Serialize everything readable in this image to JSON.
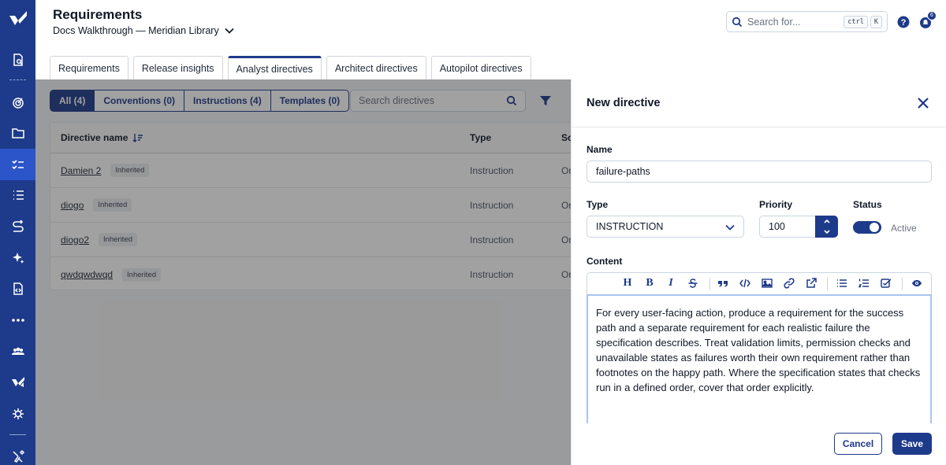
{
  "header": {
    "title": "Requirements",
    "project": "Docs Walkthrough — Meridian Library",
    "search_placeholder": "Search for...",
    "shortcut_ctrl": "ctrl",
    "shortcut_key": "K",
    "notification_count": "6"
  },
  "tabs": [
    {
      "label": "Requirements"
    },
    {
      "label": "Release insights"
    },
    {
      "label": "Analyst directives",
      "active": true
    },
    {
      "label": "Architect directives"
    },
    {
      "label": "Autopilot directives"
    }
  ],
  "filters": [
    {
      "label": "All (4)",
      "active": true
    },
    {
      "label": "Conventions (0)"
    },
    {
      "label": "Instructions (4)"
    },
    {
      "label": "Templates (0)"
    }
  ],
  "directive_search_placeholder": "Search directives",
  "table": {
    "columns": [
      "Directive name",
      "Type",
      "Sc"
    ],
    "rows": [
      {
        "name": "Damien 2",
        "badge": "Inherited",
        "type": "Instruction",
        "scope": "Or"
      },
      {
        "name": "diogo",
        "badge": "Inherited",
        "type": "Instruction",
        "scope": "Or"
      },
      {
        "name": "diogo2",
        "badge": "Inherited",
        "type": "Instruction",
        "scope": "Or"
      },
      {
        "name": "qwdqwdwqd",
        "badge": "Inherited",
        "type": "Instruction",
        "scope": "Or"
      }
    ]
  },
  "panel": {
    "title": "New directive",
    "name_label": "Name",
    "name_value": "failure-paths",
    "type_label": "Type",
    "type_value": "INSTRUCTION",
    "priority_label": "Priority",
    "priority_value": "100",
    "status_label": "Status",
    "status_value": "Active",
    "status_on": true,
    "content_label": "Content",
    "content_text": "For every user-facing action, produce a requirement for the success path and a separate requirement for each realistic failure the specification describes. Treat validation limits, permission checks and unavailable states as failures worth their own requirement rather than footnotes on the happy path. Where the specification states that checks run in a defined order, cover that order explicitly.",
    "toolbar": {
      "heading": "H",
      "bold": "B",
      "italic": "I"
    },
    "cancel_label": "Cancel",
    "save_label": "Save"
  },
  "colors": {
    "brand": "#1e3a8a",
    "sidebar_active": "#2c55c9"
  }
}
